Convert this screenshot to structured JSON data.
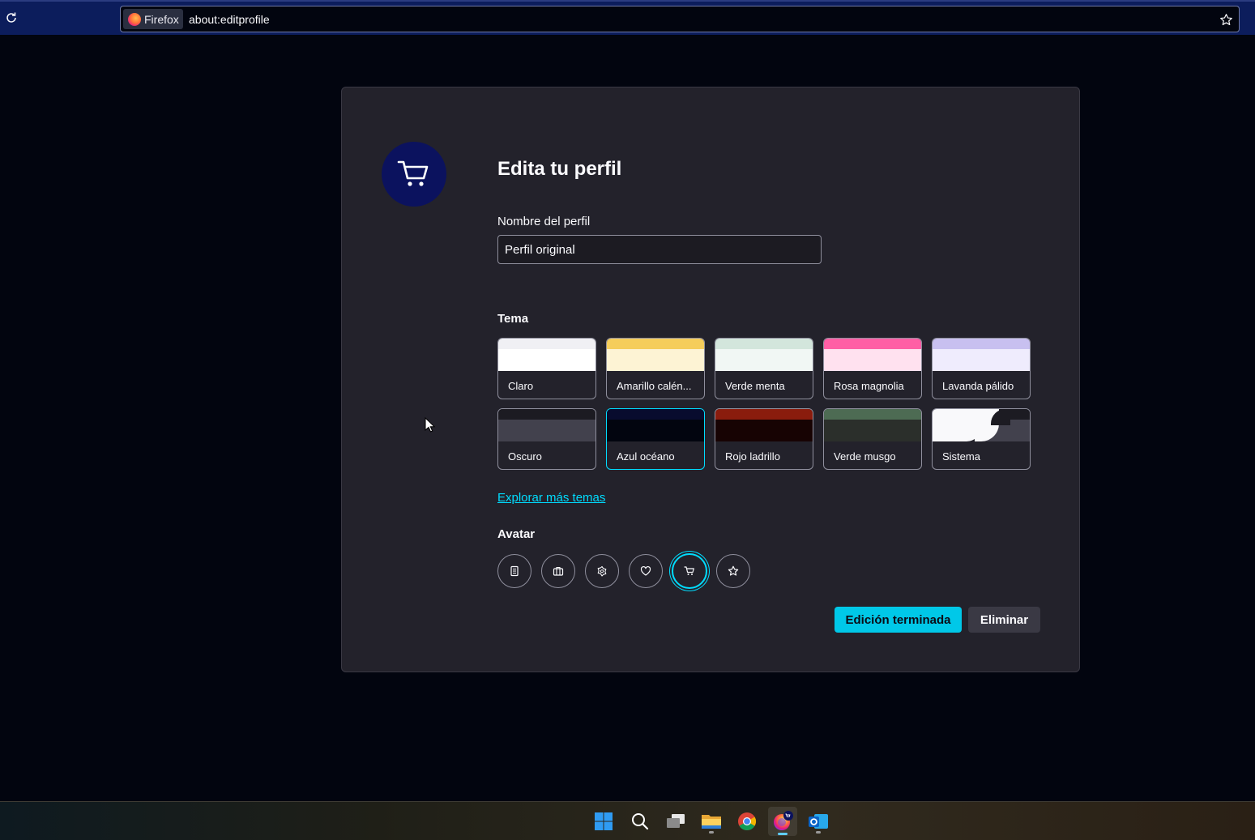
{
  "browser": {
    "identity_label": "Firefox",
    "url": "about:editprofile"
  },
  "profile": {
    "title": "Edita tu perfil",
    "name_label": "Nombre del perfil",
    "name_value": "Perfil original",
    "avatar_color": "#0b125e"
  },
  "theme_section": {
    "label": "Tema",
    "themes": [
      {
        "name": "Claro",
        "top": "#f0f0f4",
        "bottom": "#ffffff",
        "selected": false
      },
      {
        "name": "Amarillo calén...",
        "top": "#f5cd5b",
        "bottom": "#fdf3d4",
        "selected": false
      },
      {
        "name": "Verde menta",
        "top": "#d3e6dc",
        "bottom": "#f1f7f4",
        "selected": false
      },
      {
        "name": "Rosa magnolia",
        "top": "#ff5fa5",
        "bottom": "#ffe1ef",
        "selected": false
      },
      {
        "name": "Lavanda pálido",
        "top": "#c8c0f0",
        "bottom": "#efecfd",
        "selected": false
      },
      {
        "name": "Oscuro",
        "top": "#1c1b22",
        "bottom": "#42414d",
        "selected": false
      },
      {
        "name": "Azul océano",
        "top": "#080c2e",
        "bottom": "#02050f",
        "selected": true
      },
      {
        "name": "Rojo ladrillo",
        "top": "#8a1c0d",
        "bottom": "#170303",
        "selected": false
      },
      {
        "name": "Verde musgo",
        "top": "#4d6b53",
        "bottom": "#2b2f2b",
        "selected": false
      },
      {
        "name": "Sistema",
        "top": "#1c1b22",
        "bottom": "#42414d",
        "selected": false
      }
    ],
    "explore_link": "Explorar más temas"
  },
  "avatar_section": {
    "label": "Avatar",
    "avatars": [
      {
        "icon": "book-icon",
        "selected": false
      },
      {
        "icon": "briefcase-icon",
        "selected": false
      },
      {
        "icon": "flower-icon",
        "selected": false
      },
      {
        "icon": "heart-icon",
        "selected": false
      },
      {
        "icon": "shopping-cart-icon",
        "selected": true
      },
      {
        "icon": "star-icon",
        "selected": false
      }
    ]
  },
  "actions": {
    "done_label": "Edición terminada",
    "delete_label": "Eliminar"
  },
  "colors": {
    "accent": "#00ddff",
    "card_bg": "#23222b",
    "page_bg": "#02050f",
    "toolbar_bg": "#0c1d5c"
  },
  "taskbar": {
    "apps": [
      "windows-start-icon",
      "search-icon",
      "task-view-icon",
      "file-explorer-icon",
      "chrome-icon",
      "firefox-icon",
      "outlook-icon"
    ]
  }
}
